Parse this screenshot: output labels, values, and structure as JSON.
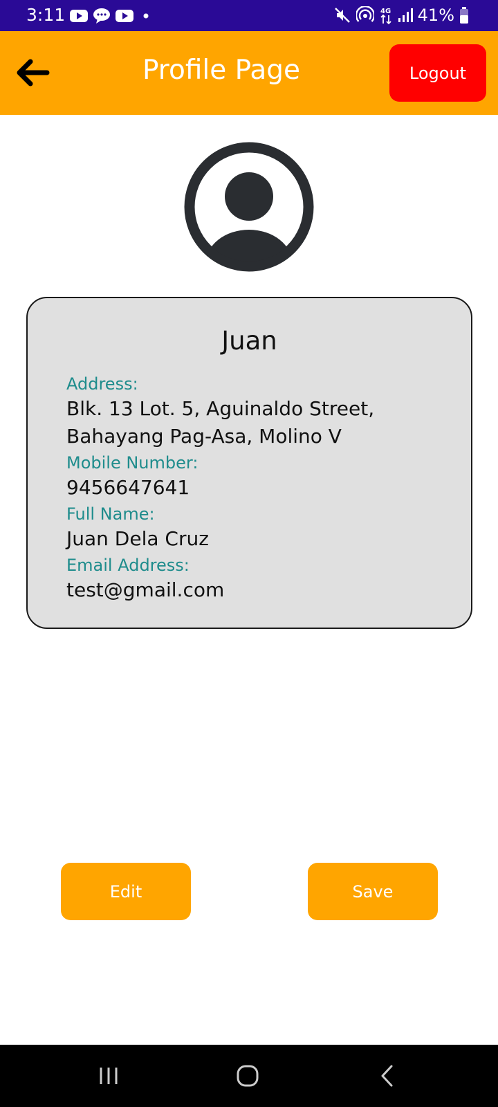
{
  "status_bar": {
    "time": "3:11",
    "battery": "41%",
    "network": "4G",
    "left_icons": [
      "youtube-icon",
      "chat-icon",
      "youtube-icon",
      "dot-icon"
    ],
    "right_icons": [
      "mute-icon",
      "hotspot-icon",
      "network-4g-icon",
      "signal-icon",
      "battery-icon"
    ]
  },
  "header": {
    "title": "Profile Page",
    "logout_label": "Logout",
    "back_icon": "arrow-left-icon"
  },
  "profile": {
    "avatar_icon": "user-avatar-icon",
    "name": "Juan",
    "address_label": "Address:",
    "address_line1": "Blk. 13 Lot. 5, Aguinaldo Street,",
    "address_line2": "Bahayang Pag-Asa, Molino V",
    "mobile_label": "Mobile Number:",
    "mobile_value": "9456647641",
    "fullname_label": "Full Name:",
    "fullname_value": "Juan Dela Cruz",
    "email_label": "Email Address:",
    "email_value": "test@gmail.com"
  },
  "actions": {
    "edit_label": "Edit",
    "save_label": "Save"
  },
  "colors": {
    "status_bar": "#2a0a96",
    "accent": "#ffa500",
    "logout": "#ff0000",
    "label_teal": "#1e8c8c",
    "card_bg": "#e0e0e0"
  },
  "nav": {
    "icons": [
      "recents-icon",
      "home-icon",
      "back-icon"
    ]
  }
}
